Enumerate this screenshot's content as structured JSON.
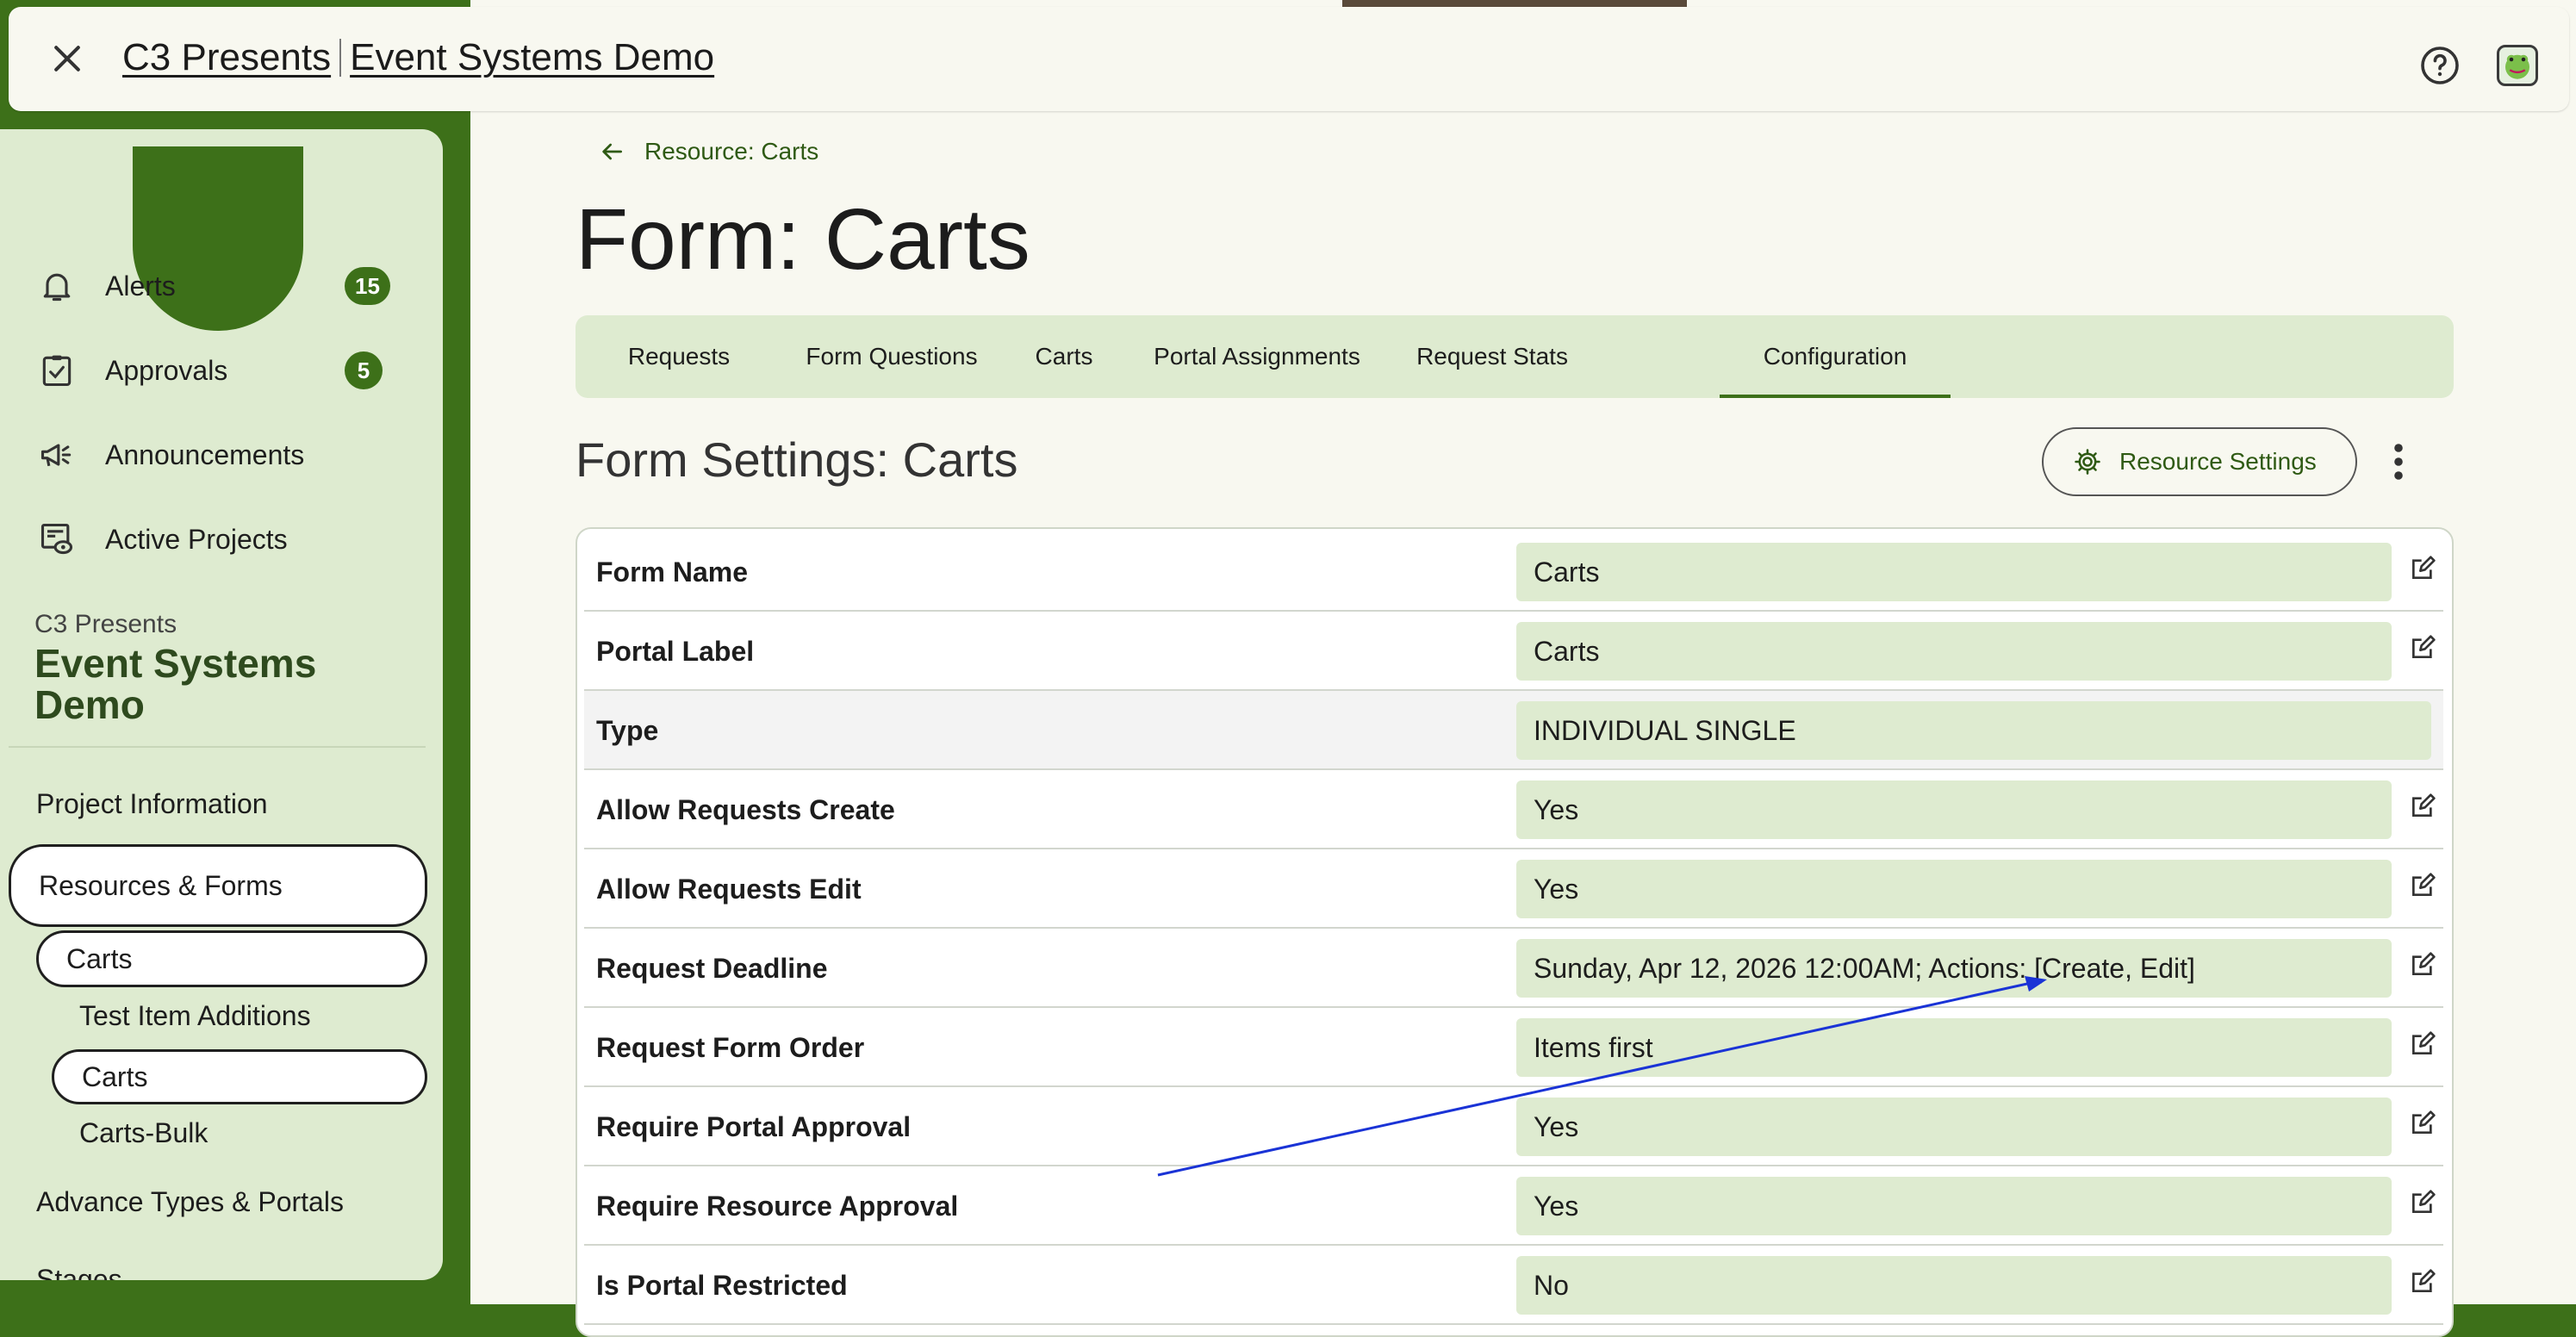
{
  "topbar": {
    "org": "C3 Presents",
    "project": "Event Systems Demo"
  },
  "sidebar": {
    "nav": [
      {
        "label": "Alerts",
        "badge": "15",
        "icon": "bell-icon"
      },
      {
        "label": "Approvals",
        "badge": "5",
        "icon": "clipboard-check-icon"
      },
      {
        "label": "Announcements",
        "icon": "megaphone-icon"
      },
      {
        "label": "Active Projects",
        "icon": "project-eye-icon"
      }
    ],
    "org": "C3 Presents",
    "project": "Event Systems Demo",
    "links": {
      "project_info": "Project Information",
      "resources_forms": "Resources & Forms",
      "carts": "Carts",
      "test_item_additions": "Test Item Additions",
      "carts_form": "Carts",
      "carts_bulk": "Carts-Bulk",
      "advance_types": "Advance Types & Portals",
      "stages": "Stages"
    }
  },
  "main": {
    "back_label": "Resource: Carts",
    "title": "Form: Carts",
    "tabs": [
      "Requests",
      "Form Questions",
      "Carts",
      "Portal Assignments",
      "Request Stats",
      "Configuration"
    ],
    "active_tab": "Configuration",
    "section_title": "Form Settings: Carts",
    "resource_settings_label": "Resource Settings",
    "rows": [
      {
        "label": "Form Name",
        "value": "Carts"
      },
      {
        "label": "Portal Label",
        "value": "Carts"
      },
      {
        "label": "Type",
        "value": "INDIVIDUAL SINGLE"
      },
      {
        "label": "Allow Requests Create",
        "value": "Yes"
      },
      {
        "label": "Allow Requests Edit",
        "value": "Yes"
      },
      {
        "label": "Request Deadline",
        "value": "Sunday, Apr 12, 2026 12:00AM; Actions: [Create, Edit]"
      },
      {
        "label": "Request Form Order",
        "value": "Items first"
      },
      {
        "label": "Require Portal Approval",
        "value": "Yes"
      },
      {
        "label": "Require Resource Approval",
        "value": "Yes"
      },
      {
        "label": "Is Portal Restricted",
        "value": "No"
      }
    ]
  },
  "colors": {
    "brand": "#3d7019",
    "accent_bg": "#deebd0",
    "page_bg": "#f8f8f0",
    "annotation": "#1a33d6"
  }
}
